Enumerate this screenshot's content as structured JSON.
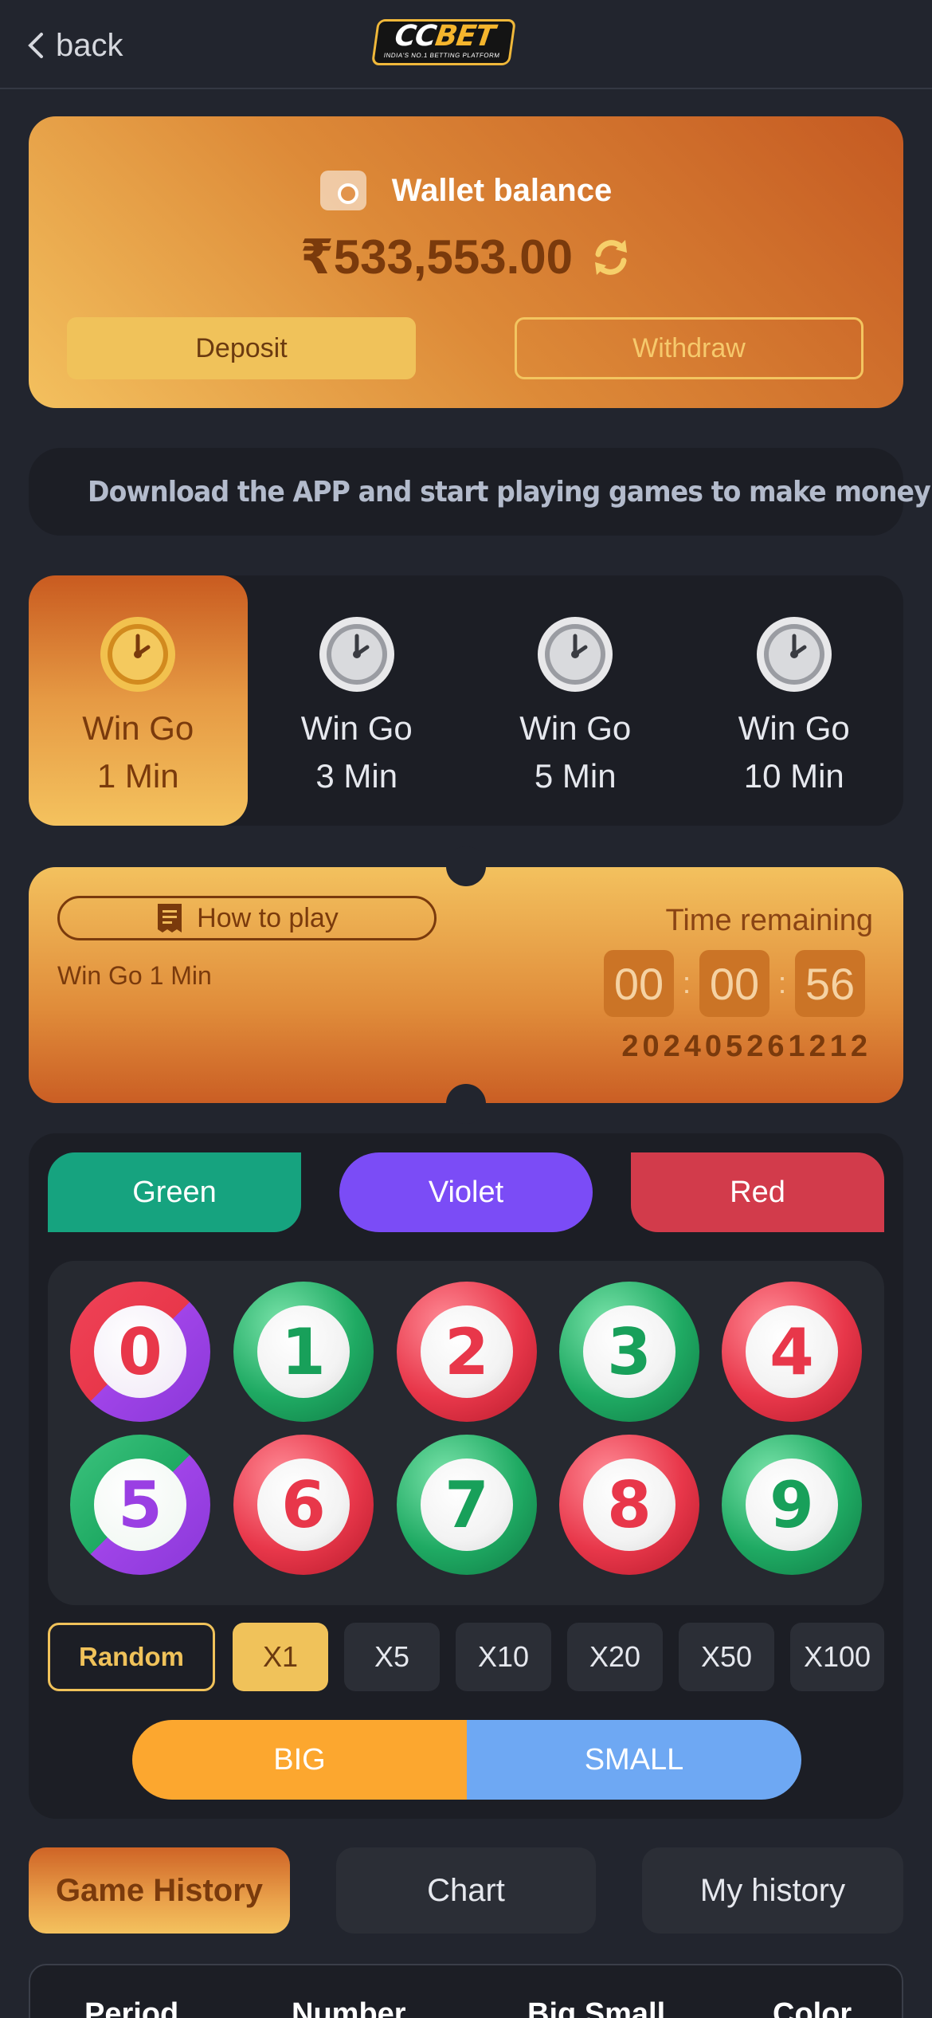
{
  "header": {
    "back_label": "back",
    "logo_main_1": "CC",
    "logo_main_2": "BET",
    "logo_tagline": "INDIA'S NO.1 BETTING PLATFORM"
  },
  "wallet": {
    "label": "Wallet balance",
    "balance": "₹533,553.00",
    "deposit_label": "Deposit",
    "withdraw_label": "Withdraw"
  },
  "notice": {
    "icon": "speaker-icon",
    "text": "Download the APP and start playing games to make money"
  },
  "game_tabs": [
    {
      "line1": "Win Go",
      "line2": "1 Min",
      "active": true
    },
    {
      "line1": "Win Go",
      "line2": "3 Min",
      "active": false
    },
    {
      "line1": "Win Go",
      "line2": "5 Min",
      "active": false
    },
    {
      "line1": "Win Go",
      "line2": "10 Min",
      "active": false
    }
  ],
  "ticket": {
    "how_to_play": "How to play",
    "game_name": "Win Go 1 Min",
    "time_label": "Time remaining",
    "timer": [
      "00",
      "00",
      "56"
    ],
    "timer_sep": ":",
    "period": "202405261212"
  },
  "colors": {
    "green": "Green",
    "violet": "Violet",
    "red": "Red"
  },
  "numbers": [
    {
      "n": "0",
      "style": "rv"
    },
    {
      "n": "1",
      "style": "green"
    },
    {
      "n": "2",
      "style": "red"
    },
    {
      "n": "3",
      "style": "green"
    },
    {
      "n": "4",
      "style": "red"
    },
    {
      "n": "5",
      "style": "gv"
    },
    {
      "n": "6",
      "style": "red"
    },
    {
      "n": "7",
      "style": "green"
    },
    {
      "n": "8",
      "style": "red"
    },
    {
      "n": "9",
      "style": "green"
    }
  ],
  "multipliers": {
    "random": "Random",
    "options": [
      "X1",
      "X5",
      "X10",
      "X20",
      "X50",
      "X100"
    ],
    "selected": "X1"
  },
  "big_small": {
    "big": "BIG",
    "small": "SMALL"
  },
  "history_tabs": {
    "game_history": "Game History",
    "chart": "Chart",
    "my_history": "My history"
  },
  "table": {
    "columns": [
      "Period",
      "Number",
      "Big Small",
      "Color"
    ]
  },
  "theme": {
    "accent": "#f0c25a",
    "green": "#16a37f",
    "violet": "#7b4cf6",
    "red": "#d23b4b",
    "big": "#fca72f",
    "small": "#6ea8f3"
  }
}
